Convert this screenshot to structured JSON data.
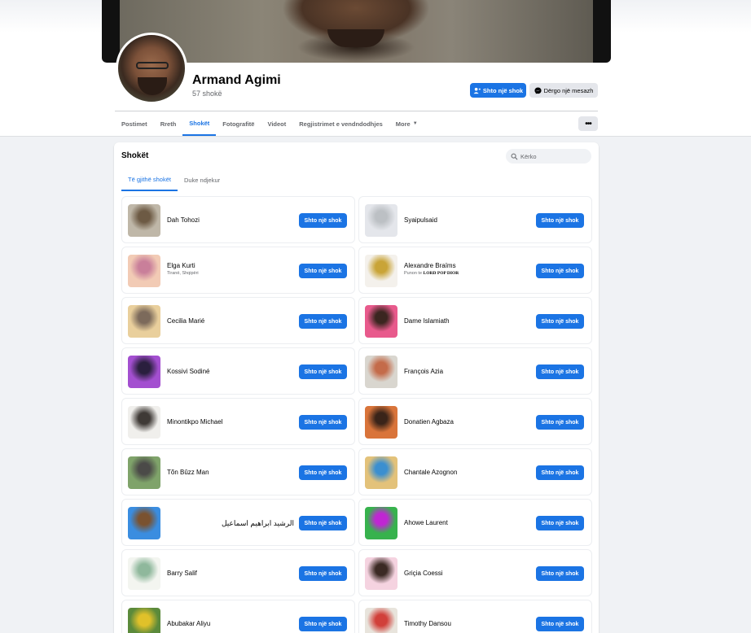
{
  "profile": {
    "name": "Armand Agimi",
    "friend_count": "57 shokë",
    "add_friend_label": "Shto një shok",
    "message_label": "Dërgo një mesazh"
  },
  "nav": {
    "tabs": [
      {
        "label": "Postimet",
        "active": false
      },
      {
        "label": "Rreth",
        "active": false
      },
      {
        "label": "Shokët",
        "active": true
      },
      {
        "label": "Fotografitë",
        "active": false
      },
      {
        "label": "Videot",
        "active": false
      },
      {
        "label": "Regjistrimet e vendndodhjes",
        "active": false
      },
      {
        "label": "More",
        "active": false
      }
    ],
    "more_button": "•••"
  },
  "friends_section": {
    "title": "Shokët",
    "search_placeholder": "Kërko",
    "subtabs": [
      {
        "label": "Të gjithë shokët",
        "active": true
      },
      {
        "label": "Duke ndjekur",
        "active": false
      }
    ],
    "button_label": "Shto një shok",
    "friends": [
      {
        "name": "Dah Tohozi",
        "thumb_colors": [
          "#bfb7a8",
          "#6d5a44"
        ]
      },
      {
        "name": "Syaipulsaid",
        "thumb_colors": [
          "#e4e6eb",
          "#bcc0c4"
        ]
      },
      {
        "name": "Elga Kurti",
        "subtitle": "Tiranë, Shqipëri",
        "thumb_colors": [
          "#f2cbb5",
          "#c97f9a"
        ]
      },
      {
        "name": "Alexandre Braïms",
        "subtitle_prefix": "Punon te",
        "subtitle_bold": "LORD POP DIOR",
        "thumb_colors": [
          "#f4f1ec",
          "#c9a437"
        ]
      },
      {
        "name": "Cecilia Marié",
        "thumb_colors": [
          "#e9cf9c",
          "#7c6a5b"
        ]
      },
      {
        "name": "Dame Islamiath",
        "thumb_colors": [
          "#e85a8c",
          "#3b2620"
        ]
      },
      {
        "name": "Kossivi Sodiné",
        "thumb_colors": [
          "#a34fd0",
          "#2a1f3e"
        ]
      },
      {
        "name": "François Azia",
        "thumb_colors": [
          "#d9d6cf",
          "#c46b4a"
        ]
      },
      {
        "name": "Minontikpo Michael",
        "thumb_colors": [
          "#f0efec",
          "#3f3a36"
        ]
      },
      {
        "name": "Donatien Agbaza",
        "thumb_colors": [
          "#d9743a",
          "#3a2419"
        ]
      },
      {
        "name": "Tõn Bûzz Man",
        "thumb_colors": [
          "#7fa36a",
          "#4b4a48"
        ]
      },
      {
        "name": "Chantale Azognon",
        "thumb_colors": [
          "#e3c27a",
          "#3b8fd0"
        ]
      },
      {
        "name": "الرشيد ابراهيم اسماعيل",
        "rtl": true,
        "thumb_colors": [
          "#3a8de0",
          "#7a5230"
        ]
      },
      {
        "name": "Ahowe Laurent",
        "thumb_colors": [
          "#37b24d",
          "#c026d3"
        ]
      },
      {
        "name": "Barry Salif",
        "thumb_colors": [
          "#f3f5f0",
          "#8fb89c"
        ]
      },
      {
        "name": "Griçia Coessi",
        "thumb_colors": [
          "#f5d3e0",
          "#3b2a24"
        ]
      },
      {
        "name": "Abubakar Aliyu",
        "thumb_colors": [
          "#5b8a3b",
          "#e0c12a"
        ]
      },
      {
        "name": "Timothy Dansou",
        "thumb_colors": [
          "#e8e4dc",
          "#d1403a"
        ]
      }
    ]
  }
}
